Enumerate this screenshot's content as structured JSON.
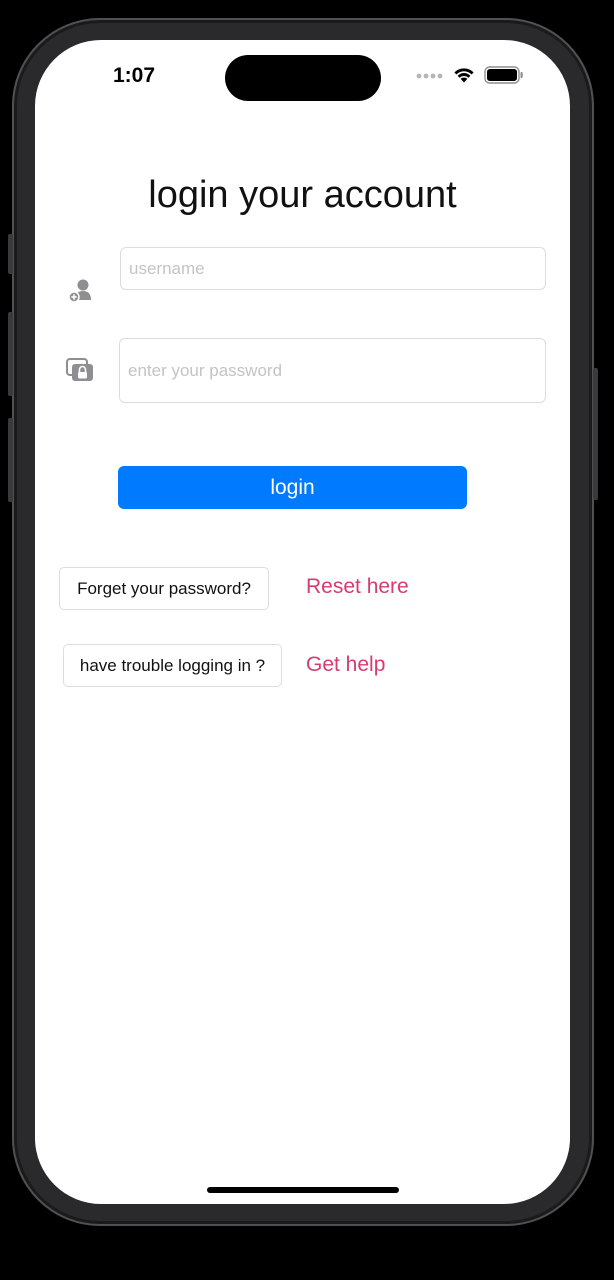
{
  "status_bar": {
    "time": "1:07"
  },
  "login": {
    "title": "login your account",
    "username_placeholder": "username",
    "password_placeholder": "enter your password",
    "login_label": "login"
  },
  "help": {
    "forget_label": "Forget your password?",
    "reset_link": "Reset here",
    "trouble_label": "have trouble logging in ?",
    "get_help_link": "Get help"
  },
  "colors": {
    "accent": "#007aff",
    "link": "#d63c71"
  },
  "icons": [
    "person-add-icon",
    "lock-icon",
    "wifi-icon",
    "battery-icon",
    "signal-icon"
  ]
}
